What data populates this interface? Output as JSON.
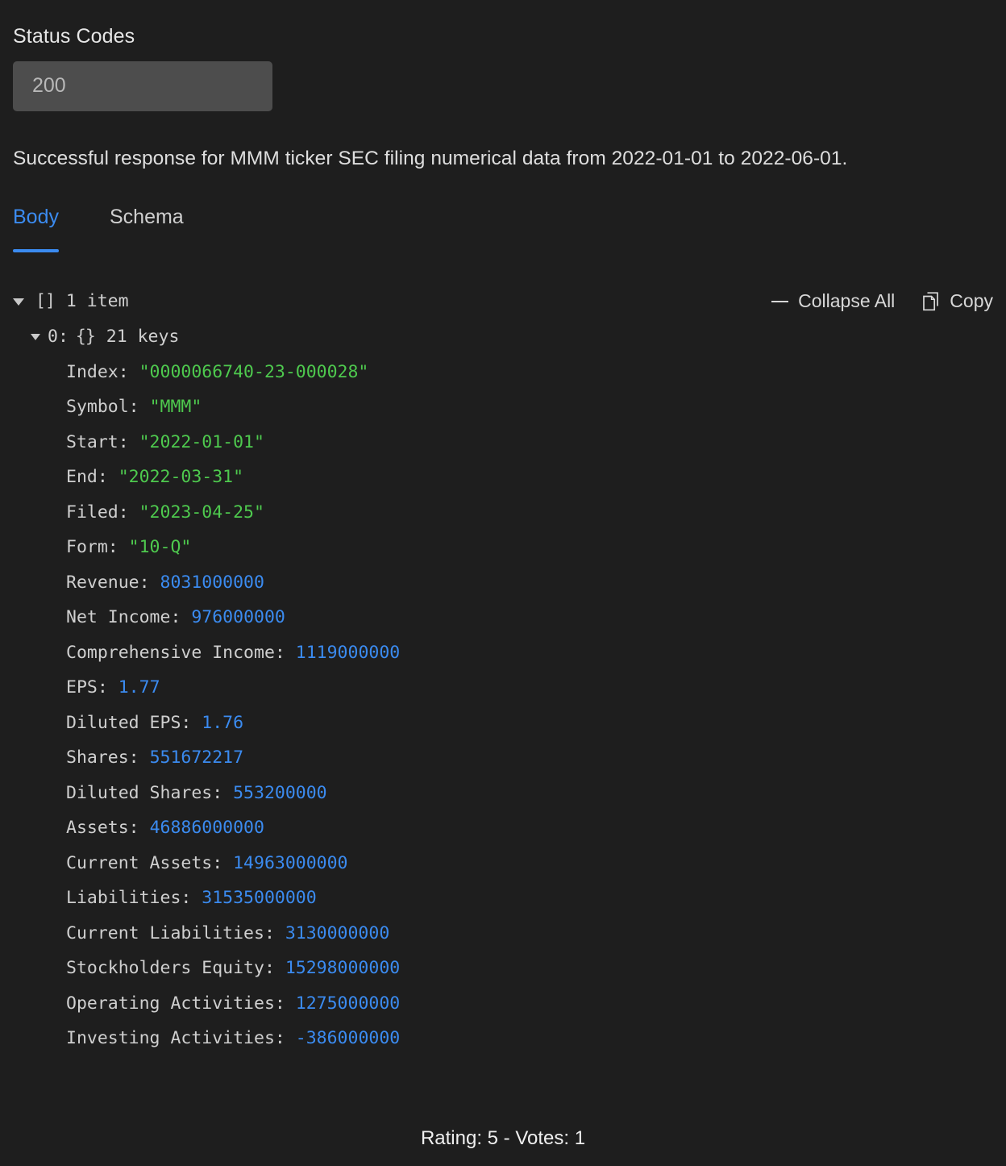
{
  "status_codes": {
    "label": "Status Codes",
    "selected": "200",
    "options": [
      "200"
    ]
  },
  "description": "Successful response for MMM ticker SEC filing numerical data from 2022-01-01 to 2022-06-01.",
  "tabs": [
    {
      "label": "Body",
      "active": true
    },
    {
      "label": "Schema",
      "active": false
    }
  ],
  "json_viewer": {
    "root": {
      "bracket": "[]",
      "summary": "1 item"
    },
    "child": {
      "index": "0:",
      "bracket": "{}",
      "summary": "21 keys"
    },
    "toolbar": {
      "collapse_all": "Collapse All",
      "copy": "Copy"
    },
    "entries": [
      {
        "key": "Index:",
        "value": "\"0000066740-23-000028\"",
        "type": "string"
      },
      {
        "key": "Symbol:",
        "value": "\"MMM\"",
        "type": "string"
      },
      {
        "key": "Start:",
        "value": "\"2022-01-01\"",
        "type": "string"
      },
      {
        "key": "End:",
        "value": "\"2022-03-31\"",
        "type": "string"
      },
      {
        "key": "Filed:",
        "value": "\"2023-04-25\"",
        "type": "string"
      },
      {
        "key": "Form:",
        "value": "\"10-Q\"",
        "type": "string"
      },
      {
        "key": "Revenue:",
        "value": "8031000000",
        "type": "number"
      },
      {
        "key": "Net Income:",
        "value": "976000000",
        "type": "number"
      },
      {
        "key": "Comprehensive Income:",
        "value": "1119000000",
        "type": "number"
      },
      {
        "key": "EPS:",
        "value": "1.77",
        "type": "number"
      },
      {
        "key": "Diluted EPS:",
        "value": "1.76",
        "type": "number"
      },
      {
        "key": "Shares:",
        "value": "551672217",
        "type": "number"
      },
      {
        "key": "Diluted Shares:",
        "value": "553200000",
        "type": "number"
      },
      {
        "key": "Assets:",
        "value": "46886000000",
        "type": "number"
      },
      {
        "key": "Current Assets:",
        "value": "14963000000",
        "type": "number"
      },
      {
        "key": "Liabilities:",
        "value": "31535000000",
        "type": "number"
      },
      {
        "key": "Current Liabilities:",
        "value": "3130000000",
        "type": "number"
      },
      {
        "key": "Stockholders Equity:",
        "value": "15298000000",
        "type": "number"
      },
      {
        "key": "Operating Activities:",
        "value": "1275000000",
        "type": "number"
      },
      {
        "key": "Investing Activities:",
        "value": "-386000000",
        "type": "number"
      }
    ]
  },
  "footer": {
    "rating_text": "Rating: 5 - Votes: 1"
  },
  "colors": {
    "background": "#1e1e1e",
    "accent": "#3b8bf0",
    "string_value": "#4ec94e",
    "number_value": "#3b8bf0",
    "select_background": "#4d4d4d"
  }
}
